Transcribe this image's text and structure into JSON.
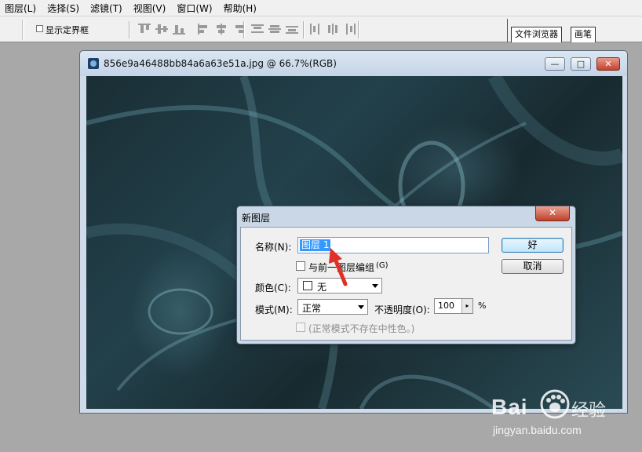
{
  "menu": [
    "图层(L)",
    "选择(S)",
    "滤镜(T)",
    "视图(V)",
    "窗口(W)",
    "帮助(H)"
  ],
  "options": {
    "show_bounds_label": "显示定界框"
  },
  "right_tabs": [
    "文件浏览器",
    "画笔"
  ],
  "document": {
    "title": "856e9a46488bb84a6a63e51a.jpg @ 66.7%(RGB)",
    "min_glyph": "—",
    "max_glyph": "□",
    "close_glyph": "✕"
  },
  "dialog": {
    "title": "新图层",
    "close_glyph": "✕",
    "name_label": "名称(N):",
    "name_value": "图层 1",
    "group_label": "与前一图层编组",
    "group_shortcut": "(G)",
    "color_label": "颜色(C):",
    "color_value": "无",
    "mode_label": "模式(M):",
    "mode_value": "正常",
    "opacity_label": "不透明度(O):",
    "opacity_value": "100",
    "opacity_stepper": "▸",
    "opacity_unit": "%",
    "neutral_label": "(正常模式不存在中性色。)",
    "ok_label": "好",
    "cancel_label": "取消"
  },
  "watermark": {
    "logo": "Bai",
    "logo2": "经验",
    "url": "jingyan.baidu.com"
  },
  "colors": {
    "arrow": "#e0302a",
    "selection": "#3399ff",
    "close_button": "#c4422c"
  }
}
